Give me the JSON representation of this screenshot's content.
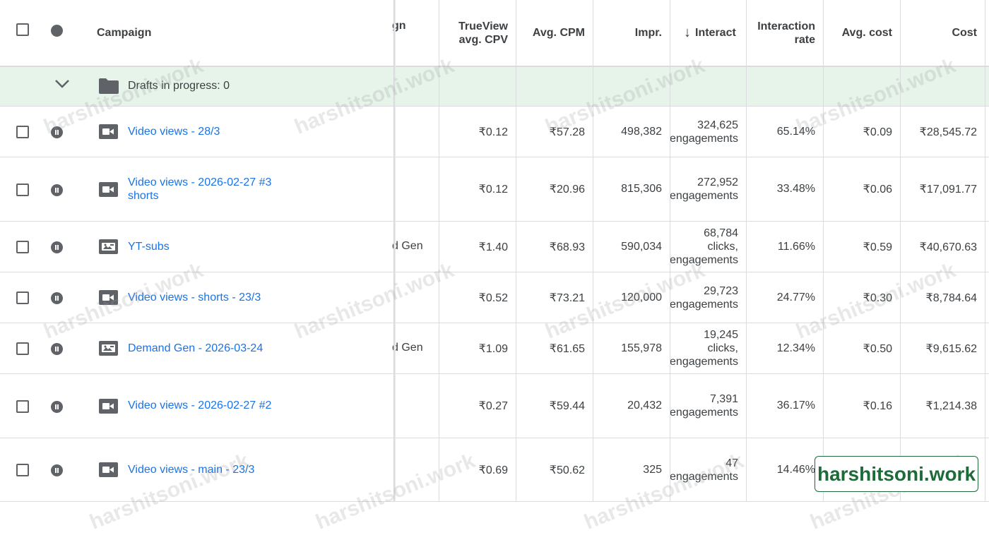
{
  "header": {
    "campaign": "Campaign",
    "campaign_type_partial": "gn",
    "trueview_cpv": "TrueView\navg. CPV",
    "avg_cpm": "Avg. CPM",
    "impr": "Impr.",
    "interactions": "Interact",
    "interaction_rate": "Interaction\nrate",
    "avg_cost": "Avg. cost",
    "cost": "Cost"
  },
  "drafts": {
    "label": "Drafts in progress:",
    "count": "0"
  },
  "rows": [
    {
      "name": "Video views - 28/3",
      "type": "video",
      "type_partial": "",
      "cpv": "₹0.12",
      "cpm": "₹57.28",
      "impr": "498,382",
      "interactions": "324,625\nengagements",
      "rate": "65.14%",
      "avg_cost": "₹0.09",
      "cost": "₹28,545.72"
    },
    {
      "name": "Video views - 2026-02-27 #3\nshorts",
      "type": "video",
      "type_partial": "",
      "cpv": "₹0.12",
      "cpm": "₹20.96",
      "impr": "815,306",
      "interactions": "272,952\nengagements",
      "rate": "33.48%",
      "avg_cost": "₹0.06",
      "cost": "₹17,091.77"
    },
    {
      "name": "YT-subs",
      "type": "demand-gen",
      "type_partial": "d Gen",
      "cpv": "₹1.40",
      "cpm": "₹68.93",
      "impr": "590,034",
      "interactions": "68,784\nclicks,\nengagements",
      "rate": "11.66%",
      "avg_cost": "₹0.59",
      "cost": "₹40,670.63"
    },
    {
      "name": "Video views - shorts - 23/3",
      "type": "video",
      "type_partial": "",
      "cpv": "₹0.52",
      "cpm": "₹73.21",
      "impr": "120,000",
      "interactions": "29,723\nengagements",
      "rate": "24.77%",
      "avg_cost": "₹0.30",
      "cost": "₹8,784.64"
    },
    {
      "name": "Demand Gen - 2026-03-24",
      "type": "demand-gen",
      "type_partial": "d Gen",
      "cpv": "₹1.09",
      "cpm": "₹61.65",
      "impr": "155,978",
      "interactions": "19,245\nclicks,\nengagements",
      "rate": "12.34%",
      "avg_cost": "₹0.50",
      "cost": "₹9,615.62"
    },
    {
      "name": "Video views - 2026-02-27 #2",
      "type": "video",
      "type_partial": "",
      "cpv": "₹0.27",
      "cpm": "₹59.44",
      "impr": "20,432",
      "interactions": "7,391\nengagements",
      "rate": "36.17%",
      "avg_cost": "₹0.16",
      "cost": "₹1,214.38"
    },
    {
      "name": "Video views - main - 23/3",
      "type": "video",
      "type_partial": "",
      "cpv": "₹0.69",
      "cpm": "₹50.62",
      "impr": "325",
      "interactions": "47\nengagements",
      "rate": "14.46%",
      "avg_cost": "",
      "cost": ""
    }
  ],
  "watermark_text": "harshitsoni.work",
  "badge_text": "harshitsoni.work",
  "colors": {
    "link": "#1a73e8",
    "drafts_bg": "#e6f4ea",
    "badge": "#1e6b3a"
  }
}
